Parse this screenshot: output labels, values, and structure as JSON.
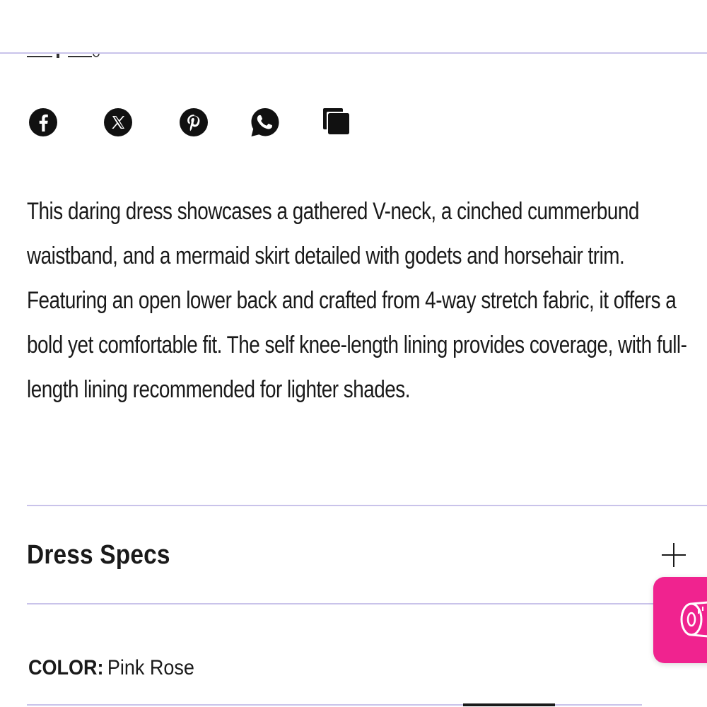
{
  "share": {
    "icons": [
      "facebook-icon",
      "x-twitter-icon",
      "pinterest-icon",
      "whatsapp-icon",
      "copy-link-icon"
    ]
  },
  "product": {
    "description": "This daring dress showcases a gathered V-neck, a cinched cummerbund waistband, and a mermaid skirt detailed with godets and horsehair trim. Featuring an open lower back and crafted from 4-way stretch fabric, it offers a bold yet comfortable fit. The self knee-length lining provides coverage, with full-length lining recommended for lighter shades."
  },
  "specs": {
    "title": "Dress Specs",
    "expand_icon": "plus-icon"
  },
  "color": {
    "label": "COLOR:",
    "value": "Pink Rose"
  },
  "widget": {
    "icon": "measuring-tape-icon",
    "background": "#f0238f"
  },
  "theme": {
    "divider_color": "#c9c3ea",
    "text_color": "#1a1a1a"
  }
}
